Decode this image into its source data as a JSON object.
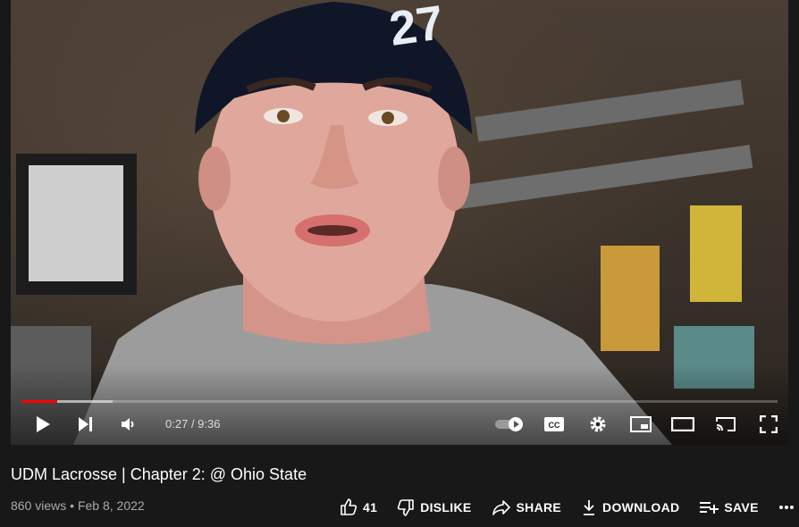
{
  "player": {
    "current_time": "0:27",
    "duration": "9:36",
    "progress_fraction": 0.047,
    "accent": "#ff0000"
  },
  "video": {
    "title": "UDM Lacrosse | Chapter 2: @ Ohio State",
    "views": "860 views",
    "separator": "•",
    "date": "Feb 8, 2022"
  },
  "actions": {
    "like_count": "41",
    "dislike_label": "DISLIKE",
    "share_label": "SHARE",
    "download_label": "DOWNLOAD",
    "save_label": "SAVE"
  },
  "scene": {
    "beanie_text": "27"
  },
  "icons": [
    "play-icon",
    "next-icon",
    "volume-icon",
    "autoplay-toggle-icon",
    "cc-icon",
    "settings-gear-icon",
    "miniplayer-icon",
    "theater-icon",
    "cast-icon",
    "fullscreen-icon",
    "thumb-up-icon",
    "thumb-down-icon",
    "share-arrow-icon",
    "download-icon",
    "save-playlist-icon",
    "more-dots-icon"
  ]
}
